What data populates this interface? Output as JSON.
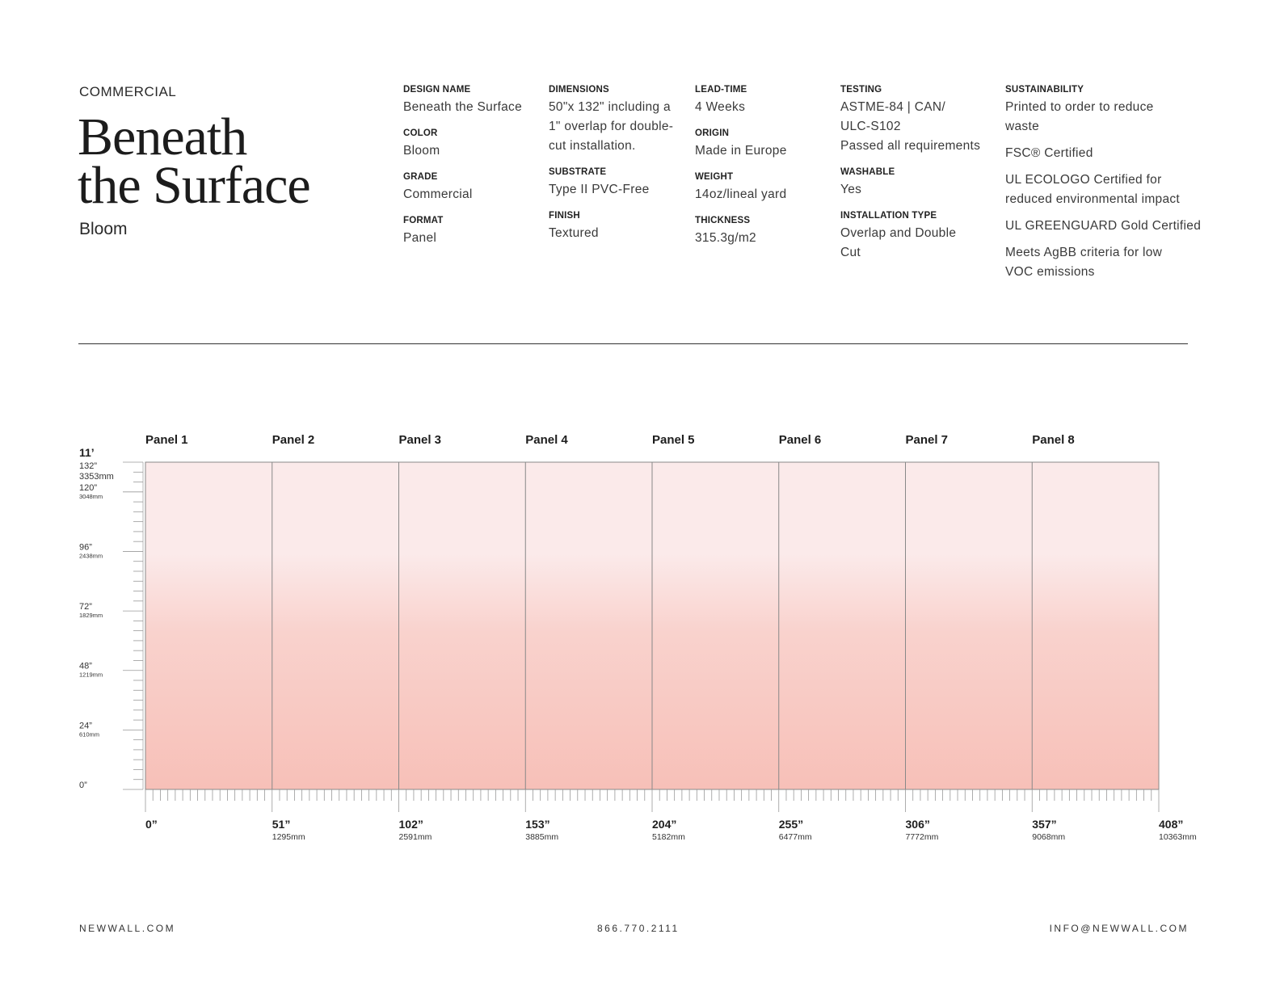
{
  "header": {
    "category": "COMMERCIAL",
    "title_line1": "Beneath",
    "title_line2": "the Surface",
    "subtitle": "Bloom"
  },
  "specs": {
    "design_name": {
      "label": "DESIGN NAME",
      "value": "Beneath the Surface"
    },
    "color": {
      "label": "COLOR",
      "value": "Bloom"
    },
    "grade": {
      "label": "GRADE",
      "value": "Commercial"
    },
    "format": {
      "label": "FORMAT",
      "value": "Panel"
    },
    "dimensions": {
      "label": "DIMENSIONS",
      "value_line1": "50\"x 132\" including a",
      "value_line2": "1\" overlap for double-",
      "value_line3": "cut installation."
    },
    "substrate": {
      "label": "SUBSTRATE",
      "value": "Type II PVC-Free"
    },
    "finish": {
      "label": "FINISH",
      "value": "Textured"
    },
    "lead_time": {
      "label": "LEAD-TIME",
      "value": "4 Weeks"
    },
    "origin": {
      "label": "ORIGIN",
      "value": "Made in Europe"
    },
    "weight": {
      "label": "WEIGHT",
      "value": "14oz/lineal yard"
    },
    "thickness": {
      "label": "THICKNESS",
      "value": "315.3g/m2"
    },
    "testing": {
      "label": "TESTING",
      "value_line1": "ASTME-84 | CAN/",
      "value_line2": "ULC-S102",
      "value_line3": "Passed all requirements"
    },
    "washable": {
      "label": "WASHABLE",
      "value": "Yes"
    },
    "installation_type": {
      "label": "INSTALLATION TYPE",
      "value_line1": "Overlap and Double",
      "value_line2": "Cut"
    },
    "sustainability": {
      "label": "SUSTAINABILITY",
      "item1_line1": "Printed to order to reduce",
      "item1_line2": "waste",
      "item2": "FSC® Certified",
      "item3_line1": "UL ECOLOGO Certified for",
      "item3_line2": "reduced environmental impact",
      "item4": "UL GREENGUARD Gold Certified",
      "item5_line1": "Meets AgBB criteria for low",
      "item5_line2": "VOC emissions"
    }
  },
  "mural": {
    "height_label": "11’",
    "panels": [
      "Panel 1",
      "Panel 2",
      "Panel 3",
      "Panel 4",
      "Panel 5",
      "Panel 6",
      "Panel 7",
      "Panel 8"
    ],
    "total_width_in": 408,
    "total_height_in": 132,
    "vertical_marks": [
      {
        "value": 132,
        "label": "132”",
        "sub": "3353mm"
      },
      {
        "value": 120,
        "label": "120”",
        "sub": "3048mm"
      },
      {
        "value": 96,
        "label": "96”",
        "sub": "2438mm"
      },
      {
        "value": 72,
        "label": "72”",
        "sub": "1829mm"
      },
      {
        "value": 48,
        "label": "48”",
        "sub": "1219mm"
      },
      {
        "value": 24,
        "label": "24”",
        "sub": "610mm"
      },
      {
        "value": 0,
        "label": "0”",
        "sub": ""
      }
    ],
    "horizontal_marks": [
      {
        "value": 0,
        "label": "0”",
        "sub": ""
      },
      {
        "value": 51,
        "label": "51”",
        "sub": "1295mm"
      },
      {
        "value": 102,
        "label": "102”",
        "sub": "2591mm"
      },
      {
        "value": 153,
        "label": "153”",
        "sub": "3885mm"
      },
      {
        "value": 204,
        "label": "204”",
        "sub": "5182mm"
      },
      {
        "value": 255,
        "label": "255”",
        "sub": "6477mm"
      },
      {
        "value": 306,
        "label": "306”",
        "sub": "7772mm"
      },
      {
        "value": 357,
        "label": "357”",
        "sub": "9068mm"
      },
      {
        "value": 408,
        "label": "408”",
        "sub": "10363mm"
      }
    ],
    "colors": {
      "top": "#fbeaea",
      "bottom": "#f7c0b8",
      "line": "#888888"
    }
  },
  "footer": {
    "website": "NEWWALL.COM",
    "phone": "866.770.2111",
    "email": "INFO@NEWWALL.COM"
  }
}
